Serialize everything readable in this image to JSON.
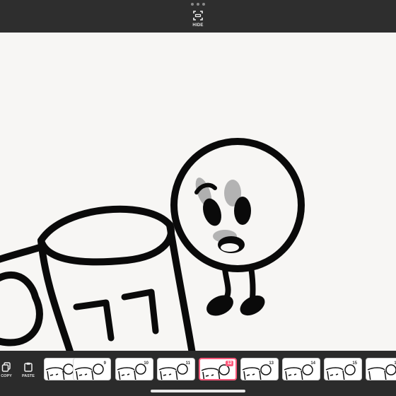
{
  "toolbar": {
    "hide_label": "HIDE"
  },
  "timeline": {
    "copy_label": "COPY",
    "paste_label": "PASTE",
    "active_frame": "12",
    "frames": [
      "8",
      "9",
      "10",
      "11",
      "12",
      "13",
      "14",
      "15",
      "16"
    ]
  },
  "colors": {
    "accent": "#ff5a7c",
    "chrome": "#2e2e2e",
    "paper": "#f7f6f4"
  }
}
